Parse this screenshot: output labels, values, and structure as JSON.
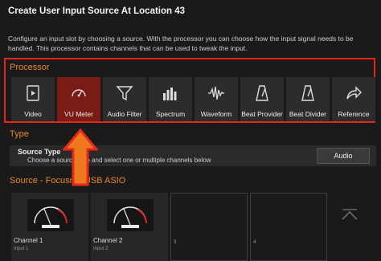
{
  "dialog": {
    "title": "Create User Input Source At Location 43",
    "description": "Configure an input slot by choosing a source. With the processor you can choose how the input signal needs to be handled. This processor contains channels that can be used to tweak the input."
  },
  "processor": {
    "label": "Processor",
    "selected": "VU Meter",
    "items": [
      {
        "label": "Video",
        "icon": "video-icon"
      },
      {
        "label": "VU Meter",
        "icon": "gauge-icon"
      },
      {
        "label": "Audio Filter",
        "icon": "filter-icon"
      },
      {
        "label": "Spectrum",
        "icon": "spectrum-icon"
      },
      {
        "label": "Waveform",
        "icon": "waveform-icon"
      },
      {
        "label": "Beat Provider",
        "icon": "metronome-icon"
      },
      {
        "label": "Beat Divider",
        "icon": "metronome-icon"
      },
      {
        "label": "Reference",
        "icon": "share-arrow-icon"
      }
    ]
  },
  "type": {
    "label": "Type",
    "source_type_label": "Source Type",
    "source_type_hint": "Choose a source type and select one or multiple channels below",
    "audio_button": "Audio"
  },
  "source": {
    "label": "Source - Focusrite USB ASIO",
    "channels": [
      {
        "name": "Channel 1",
        "sub": "Input 1"
      },
      {
        "name": "Channel 2",
        "sub": "Input 2"
      },
      {
        "name": "",
        "sub": "3"
      },
      {
        "name": "",
        "sub": "4"
      }
    ]
  },
  "colors": {
    "accent_orange": "#e8872c",
    "highlight_red": "#e8251c",
    "selected_tile": "#7a1b16"
  }
}
